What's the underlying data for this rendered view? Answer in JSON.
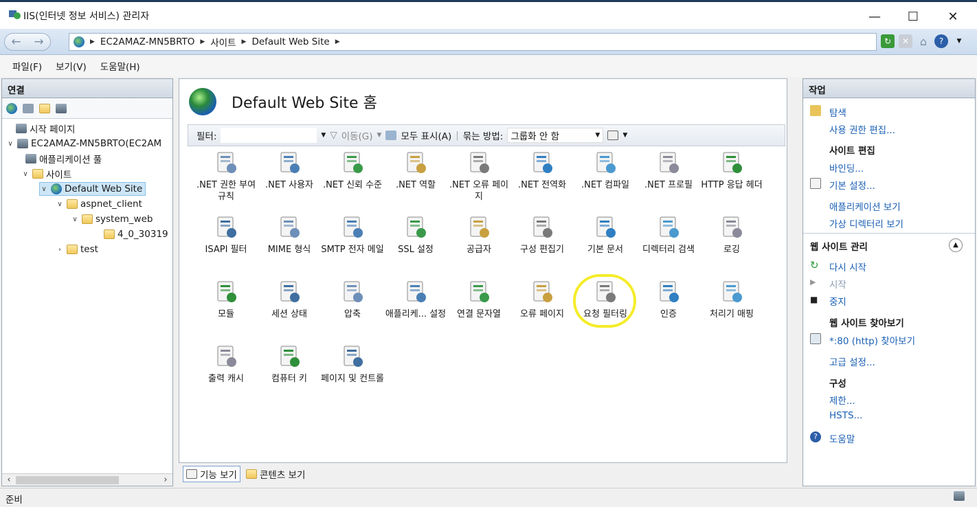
{
  "window": {
    "title": "IIS(인터넷 정보 서비스) 관리자"
  },
  "address": {
    "crumbs": [
      "EC2AMAZ-MN5BRTO",
      "사이트",
      "Default Web Site"
    ]
  },
  "menu": [
    "파일(F)",
    "보기(V)",
    "도움말(H)"
  ],
  "connections": {
    "title": "연결",
    "tree": [
      {
        "label": "시작 페이지"
      },
      {
        "label": "EC2AMAZ-MN5BRTO(EC2AM"
      },
      {
        "label": "애플리케이션 풀"
      },
      {
        "label": "사이트"
      },
      {
        "label": "Default Web Site"
      },
      {
        "label": "aspnet_client"
      },
      {
        "label": "system_web"
      },
      {
        "label": "4_0_30319"
      },
      {
        "label": "test"
      }
    ]
  },
  "center": {
    "title": "Default Web Site 홈",
    "filter_label": "필터:",
    "go_label": "이동(G)",
    "show_all_label": "모두 표시(A)",
    "group_by_label": "묶는 방법:",
    "group_by_value": "그룹화 안 함",
    "features": [
      {
        "label": ".NET 권한 부여 규칙",
        "icon": "net-authorization-icon"
      },
      {
        "label": ".NET 사용자",
        "icon": "net-users-icon"
      },
      {
        "label": ".NET 신뢰 수준",
        "icon": "net-trust-icon"
      },
      {
        "label": ".NET 역할",
        "icon": "net-roles-icon"
      },
      {
        "label": ".NET 오류 페이지",
        "icon": "net-error-pages-icon"
      },
      {
        "label": ".NET 전역화",
        "icon": "net-globalization-icon"
      },
      {
        "label": ".NET 컴파일",
        "icon": "net-compilation-icon"
      },
      {
        "label": ".NET 프로필",
        "icon": "net-profile-icon"
      },
      {
        "label": "HTTP 응답 헤더",
        "icon": "http-headers-icon"
      },
      {
        "label": "ISAPI 필터",
        "icon": "isapi-filters-icon"
      },
      {
        "label": "MIME 형식",
        "icon": "mime-types-icon"
      },
      {
        "label": "SMTP 전자 메일",
        "icon": "smtp-email-icon"
      },
      {
        "label": "SSL 설정",
        "icon": "ssl-lock-icon"
      },
      {
        "label": "공급자",
        "icon": "providers-icon"
      },
      {
        "label": "구성 편집기",
        "icon": "config-editor-icon"
      },
      {
        "label": "기본 문서",
        "icon": "default-document-icon"
      },
      {
        "label": "디렉터리 검색",
        "icon": "directory-browsing-icon"
      },
      {
        "label": "로깅",
        "icon": "logging-icon"
      },
      {
        "label": "모듈",
        "icon": "modules-icon"
      },
      {
        "label": "세션 상태",
        "icon": "session-state-icon"
      },
      {
        "label": "압축",
        "icon": "compression-icon"
      },
      {
        "label": "애플리케... 설정",
        "icon": "app-settings-icon"
      },
      {
        "label": "연결 문자열",
        "icon": "connection-strings-icon"
      },
      {
        "label": "오류 페이지",
        "icon": "error-pages-icon"
      },
      {
        "label": "요청 필터링",
        "icon": "request-filtering-icon"
      },
      {
        "label": "인증",
        "icon": "authentication-icon"
      },
      {
        "label": "처리기 매핑",
        "icon": "handler-mappings-icon"
      },
      {
        "label": "출력 캐시",
        "icon": "output-cache-icon"
      },
      {
        "label": "컴퓨터 키",
        "icon": "machine-key-icon"
      },
      {
        "label": "페이지 및 컨트롤",
        "icon": "pages-controls-icon"
      }
    ],
    "tabs": {
      "features": "기능 보기",
      "content": "콘텐츠 보기"
    }
  },
  "actions": {
    "title": "작업",
    "explore": "탐색",
    "edit_permissions": "사용 권한 편집...",
    "edit_site": "사이트 편집",
    "bindings": "바인딩...",
    "basic_settings": "기본 설정...",
    "view_apps": "애플리케이션 보기",
    "view_vdirs": "가상 디렉터리 보기",
    "manage_site": "웹 사이트 관리",
    "restart": "다시 시작",
    "start": "시작",
    "stop": "중지",
    "browse_site": "웹 사이트 찾아보기",
    "browse_80": "*:80 (http) 찾아보기",
    "advanced": "고급 설정...",
    "configure": "구성",
    "limits": "제한...",
    "hsts": "HSTS...",
    "help": "도움말"
  },
  "status": {
    "text": "준비"
  }
}
